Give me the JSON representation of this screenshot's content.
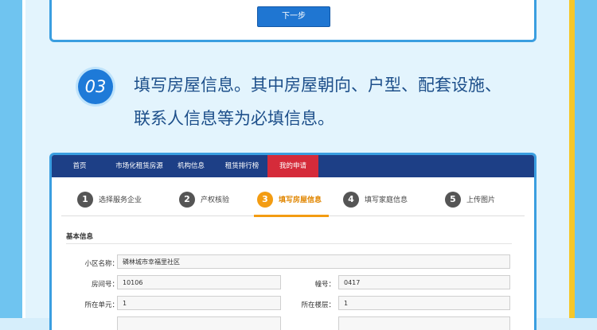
{
  "top_card": {
    "next_button": "下一步"
  },
  "step": {
    "number": "03",
    "description_line1": "填写房屋信息。其中房屋朝向、户型、配套设施、",
    "description_line2": "联系人信息等为必填信息。"
  },
  "nav": {
    "items": [
      {
        "label": "首页"
      },
      {
        "label": "市场化租赁房源"
      },
      {
        "label": "机构信息"
      },
      {
        "label": "租赁排行榜"
      },
      {
        "label": "我的申请"
      }
    ],
    "active_index": 4
  },
  "steps": [
    {
      "num": "1",
      "label": "选择服务企业"
    },
    {
      "num": "2",
      "label": "产权核验"
    },
    {
      "num": "3",
      "label": "填写房屋信息"
    },
    {
      "num": "4",
      "label": "填写家庭信息"
    },
    {
      "num": "5",
      "label": "上传图片"
    }
  ],
  "form": {
    "section_title": "基本信息",
    "community_label": "小区名称：",
    "community_value": "磷林城市幸福里社区",
    "room_label": "房间号：",
    "room_value": "10106",
    "building_label": "幢号：",
    "building_value": "0417",
    "unit_label": "所在单元：",
    "unit_value": "1",
    "floor_label": "所在楼层：",
    "floor_value": "1"
  },
  "colors": {
    "primary_blue": "#1e7ad8",
    "nav_blue": "#1d3f86",
    "active_red": "#d52b3a",
    "step_active": "#f39c12",
    "accent_yellow": "#f5c72a"
  }
}
